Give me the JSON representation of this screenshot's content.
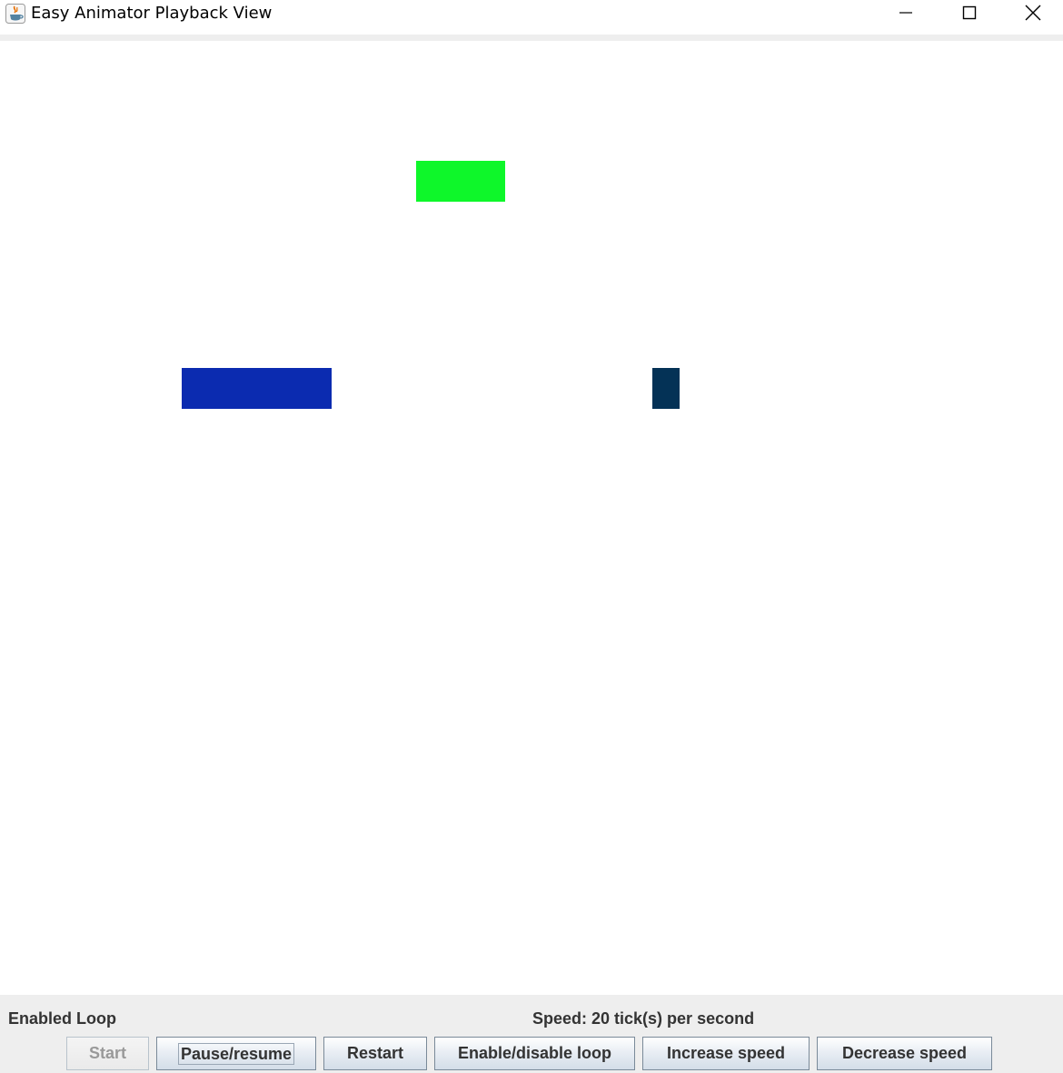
{
  "window": {
    "title": "Easy Animator Playback View",
    "app_icon": "java-icon",
    "controls": {
      "minimize_icon": "minimize-icon",
      "maximize_icon": "maximize-icon",
      "close_icon": "close-icon"
    }
  },
  "canvas": {
    "background": "#ffffff",
    "shapes": [
      {
        "name": "green-rectangle",
        "type": "rectangle",
        "color": "#0ef72a"
      },
      {
        "name": "blue-rectangle",
        "type": "rectangle",
        "color": "#0b2bb0"
      },
      {
        "name": "navy-rectangle",
        "type": "rectangle",
        "color": "#043256"
      }
    ]
  },
  "status": {
    "loop": "Enabled Loop",
    "speed": "Speed: 20 tick(s) per second"
  },
  "buttons": {
    "start": "Start",
    "pause_resume": "Pause/resume",
    "restart": "Restart",
    "toggle_loop": "Enable/disable loop",
    "increase_speed": "Increase speed",
    "decrease_speed": "Decrease speed"
  },
  "colors": {
    "panel_background": "#eeeeee",
    "button_text": "#333333",
    "disabled_text": "#999999"
  }
}
